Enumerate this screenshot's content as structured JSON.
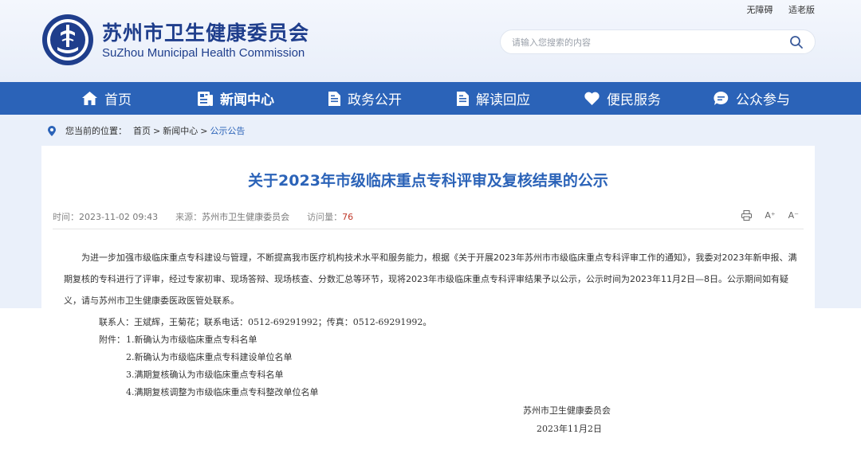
{
  "header": {
    "title": "苏州市卫生健康委员会",
    "subtitle": "SuZhou Municipal Health Commission",
    "top_links": [
      "无障碍",
      "适老版"
    ],
    "search_placeholder": "请输入您搜索的内容"
  },
  "nav": {
    "items": [
      {
        "label": "首页",
        "icon": "home-icon"
      },
      {
        "label": "新闻中心",
        "icon": "news-icon",
        "active": true
      },
      {
        "label": "政务公开",
        "icon": "document-icon"
      },
      {
        "label": "解读回应",
        "icon": "document-icon"
      },
      {
        "label": "便民服务",
        "icon": "heart-icon"
      },
      {
        "label": "公众参与",
        "icon": "chat-icon"
      }
    ]
  },
  "breadcrumb": {
    "prefix": "您当前的位置：",
    "items": [
      "首页",
      "新闻中心",
      "公示公告"
    ],
    "separator": ">"
  },
  "article": {
    "title": "关于2023年市级临床重点专科评审及复核结果的公示",
    "time_label": "时间：",
    "time": "2023-11-02 09:43",
    "source_label": "来源：",
    "source": "苏州市卫生健康委员会",
    "views_label": "访问量：",
    "views": "76",
    "tools": [
      "print-icon",
      "font-increase-icon",
      "font-decrease-icon"
    ],
    "tool_labels": {
      "increase": "A⁺",
      "decrease": "A⁻"
    },
    "paragraph": "为进一步加强市级临床重点专科建设与管理，不断提高我市医疗机构技术水平和服务能力，根据《关于开展2023年苏州市市级临床重点专科评审工作的通知》，我委对2023年新申报、满期复核的专科进行了评审，经过专家初审、现场答辩、现场核查、分数汇总等环节，现将2023年市级临床重点专科评审结果予以公示，公示时间为2023年11月2日—8日。公示期间如有疑义，请与苏州市卫生健康委医政医管处联系。",
    "contact": "联系人：王斌辉，王菊花；联系电话：0512-69291992；传真：0512-69291992。",
    "attachments_label": "附件：",
    "attachments": [
      "1.新确认为市级临床重点专科名单",
      "2.新确认为市级临床重点专科建设单位名单",
      "3.满期复核确认为市级临床重点专科名单",
      "4.满期复核调整为市级临床重点专科整改单位名单"
    ],
    "signature": "苏州市卫生健康委员会",
    "sign_date": "2023年11月2日"
  },
  "colors": {
    "primary": "#2b63b8",
    "title_blue": "#1f3e8c",
    "views_red": "#c0392b"
  }
}
